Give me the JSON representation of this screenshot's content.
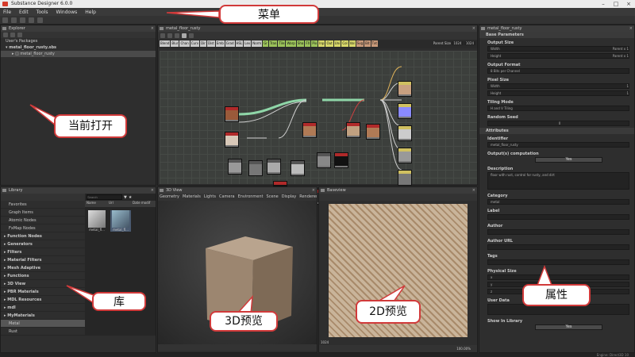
{
  "window": {
    "title": "Substance Designer 6.0.0"
  },
  "menu": [
    "File",
    "Edit",
    "Tools",
    "Windows",
    "Help"
  ],
  "explorer": {
    "title": "Explorer",
    "user_packages": "User's Packages",
    "package": "metal_floor_rusty.sbs",
    "graph": "metal_floor_rusty"
  },
  "graph": {
    "title": "metal_floor_rusty",
    "parent_size_label": "Parent Size",
    "parent_size_value": "1024",
    "size_value": "1024",
    "atomic_nodes": [
      {
        "label": "Blend",
        "color": "#c9c9c9"
      },
      {
        "label": "Blur",
        "color": "#c9c9c9"
      },
      {
        "label": "Chan",
        "color": "#c9c9c9"
      },
      {
        "label": "Curv",
        "color": "#c9c9c9"
      },
      {
        "label": "Dir",
        "color": "#c9c9c9"
      },
      {
        "label": "Dist",
        "color": "#c9c9c9"
      },
      {
        "label": "Emb",
        "color": "#c9c9c9"
      },
      {
        "label": "Grad",
        "color": "#c9c9c9"
      },
      {
        "label": "HSL",
        "color": "#c9c9c9"
      },
      {
        "label": "Lev",
        "color": "#c9c9c9"
      },
      {
        "label": "Norm",
        "color": "#c9c9c9"
      },
      {
        "label": "Gr",
        "color": "#9bc25a"
      },
      {
        "label": "Tran",
        "color": "#9bc25a"
      },
      {
        "label": "Tile",
        "color": "#9bc25a"
      },
      {
        "label": "Warp",
        "color": "#9bc25a"
      },
      {
        "label": "Sha",
        "color": "#9bc25a"
      },
      {
        "label": "FX",
        "color": "#9bc25a"
      },
      {
        "label": "Pix",
        "color": "#9bc25a"
      },
      {
        "label": "Inp",
        "color": "#d8d86a"
      },
      {
        "label": "Out",
        "color": "#d8d86a"
      },
      {
        "label": "Uni",
        "color": "#d8d86a"
      },
      {
        "label": "Col",
        "color": "#d8d86a"
      },
      {
        "label": "Val",
        "color": "#d8d86a"
      },
      {
        "label": "Svg",
        "color": "#c99a7a"
      },
      {
        "label": "Bit",
        "color": "#c99a7a"
      },
      {
        "label": "Txt",
        "color": "#c99a7a"
      }
    ],
    "node_label": "Node label"
  },
  "library": {
    "title": "Library",
    "search_placeholder": "Search",
    "columns": [
      "Name",
      "Url",
      "Date modif"
    ],
    "categories": [
      {
        "label": "Favorites",
        "bold": false,
        "selected": false
      },
      {
        "label": "Graph Items",
        "bold": false,
        "selected": false
      },
      {
        "label": "Atomic Nodes",
        "bold": false,
        "selected": false
      },
      {
        "label": "FxMap Nodes",
        "bold": false,
        "selected": false
      },
      {
        "label": "Function Nodes",
        "bold": true,
        "selected": false
      },
      {
        "label": "Generators",
        "bold": true,
        "selected": false
      },
      {
        "label": "Filters",
        "bold": true,
        "selected": false
      },
      {
        "label": "Material Filters",
        "bold": true,
        "selected": false
      },
      {
        "label": "Mesh Adaptive",
        "bold": true,
        "selected": false
      },
      {
        "label": "Functions",
        "bold": true,
        "selected": false
      },
      {
        "label": "3D View",
        "bold": true,
        "selected": false
      },
      {
        "label": "PBR Materials",
        "bold": true,
        "selected": false
      },
      {
        "label": "MDL Resources",
        "bold": true,
        "selected": false
      },
      {
        "label": "mdl",
        "bold": true,
        "selected": false
      },
      {
        "label": "MyMaterials",
        "bold": true,
        "selected": false
      },
      {
        "label": "Metal",
        "bold": false,
        "selected": true
      },
      {
        "label": "Rust",
        "bold": false,
        "selected": false
      }
    ],
    "thumbs": [
      {
        "label": "metal_fl..."
      },
      {
        "label": "metal_fl..."
      }
    ]
  },
  "view3d": {
    "title": "3D View",
    "menu": [
      "Geometry",
      "Materials",
      "Lights",
      "Camera",
      "Environment",
      "Scene",
      "Display",
      "Renderer"
    ]
  },
  "view2d": {
    "title": "Baseview",
    "resolution": "1024",
    "zoom": "100.00%"
  },
  "properties": {
    "title": "metal_floor_rusty",
    "base_parameters": "Base Parameters",
    "output_size": "Output Size",
    "width_label": "Width",
    "height_label": "Height",
    "width_val": "Parent x 1",
    "height_val": "Parent x 1",
    "output_format": "Output Format",
    "output_format_val": "8 Bits per Channel",
    "pixel_size": "Pixel Size",
    "pixel_w": "1",
    "pixel_h": "1",
    "tiling_mode": "Tiling Mode",
    "tiling_val": "H and V Tiling",
    "random_seed": "Random Seed",
    "random_val": "0",
    "attributes": "Attributes",
    "identifier": "Identifier",
    "identifier_val": "metal_floor_rusty",
    "outputs_comp": "Output(s) computation",
    "yes": "Yes",
    "description": "Description",
    "description_val": "floor with rust, control for rusty, and dirt",
    "category": "Category",
    "category_val": "metal",
    "label": "Label",
    "author": "Author",
    "author_url": "Author URL",
    "tags": "Tags",
    "physical_size": "Physical Size",
    "xyz": [
      "x",
      "y",
      "z"
    ],
    "user_data": "User Data",
    "show_in_library": "Show In Library",
    "engine": "Engine: Direct3D 10"
  },
  "callouts": {
    "menu": "菜单",
    "current_open": "当前打开",
    "library": "库",
    "preview3d": "3D预览",
    "preview2d": "2D预览",
    "properties": "属性"
  },
  "colors": {
    "callout_border": "#d13a3a",
    "accent": "#d63b2a"
  }
}
